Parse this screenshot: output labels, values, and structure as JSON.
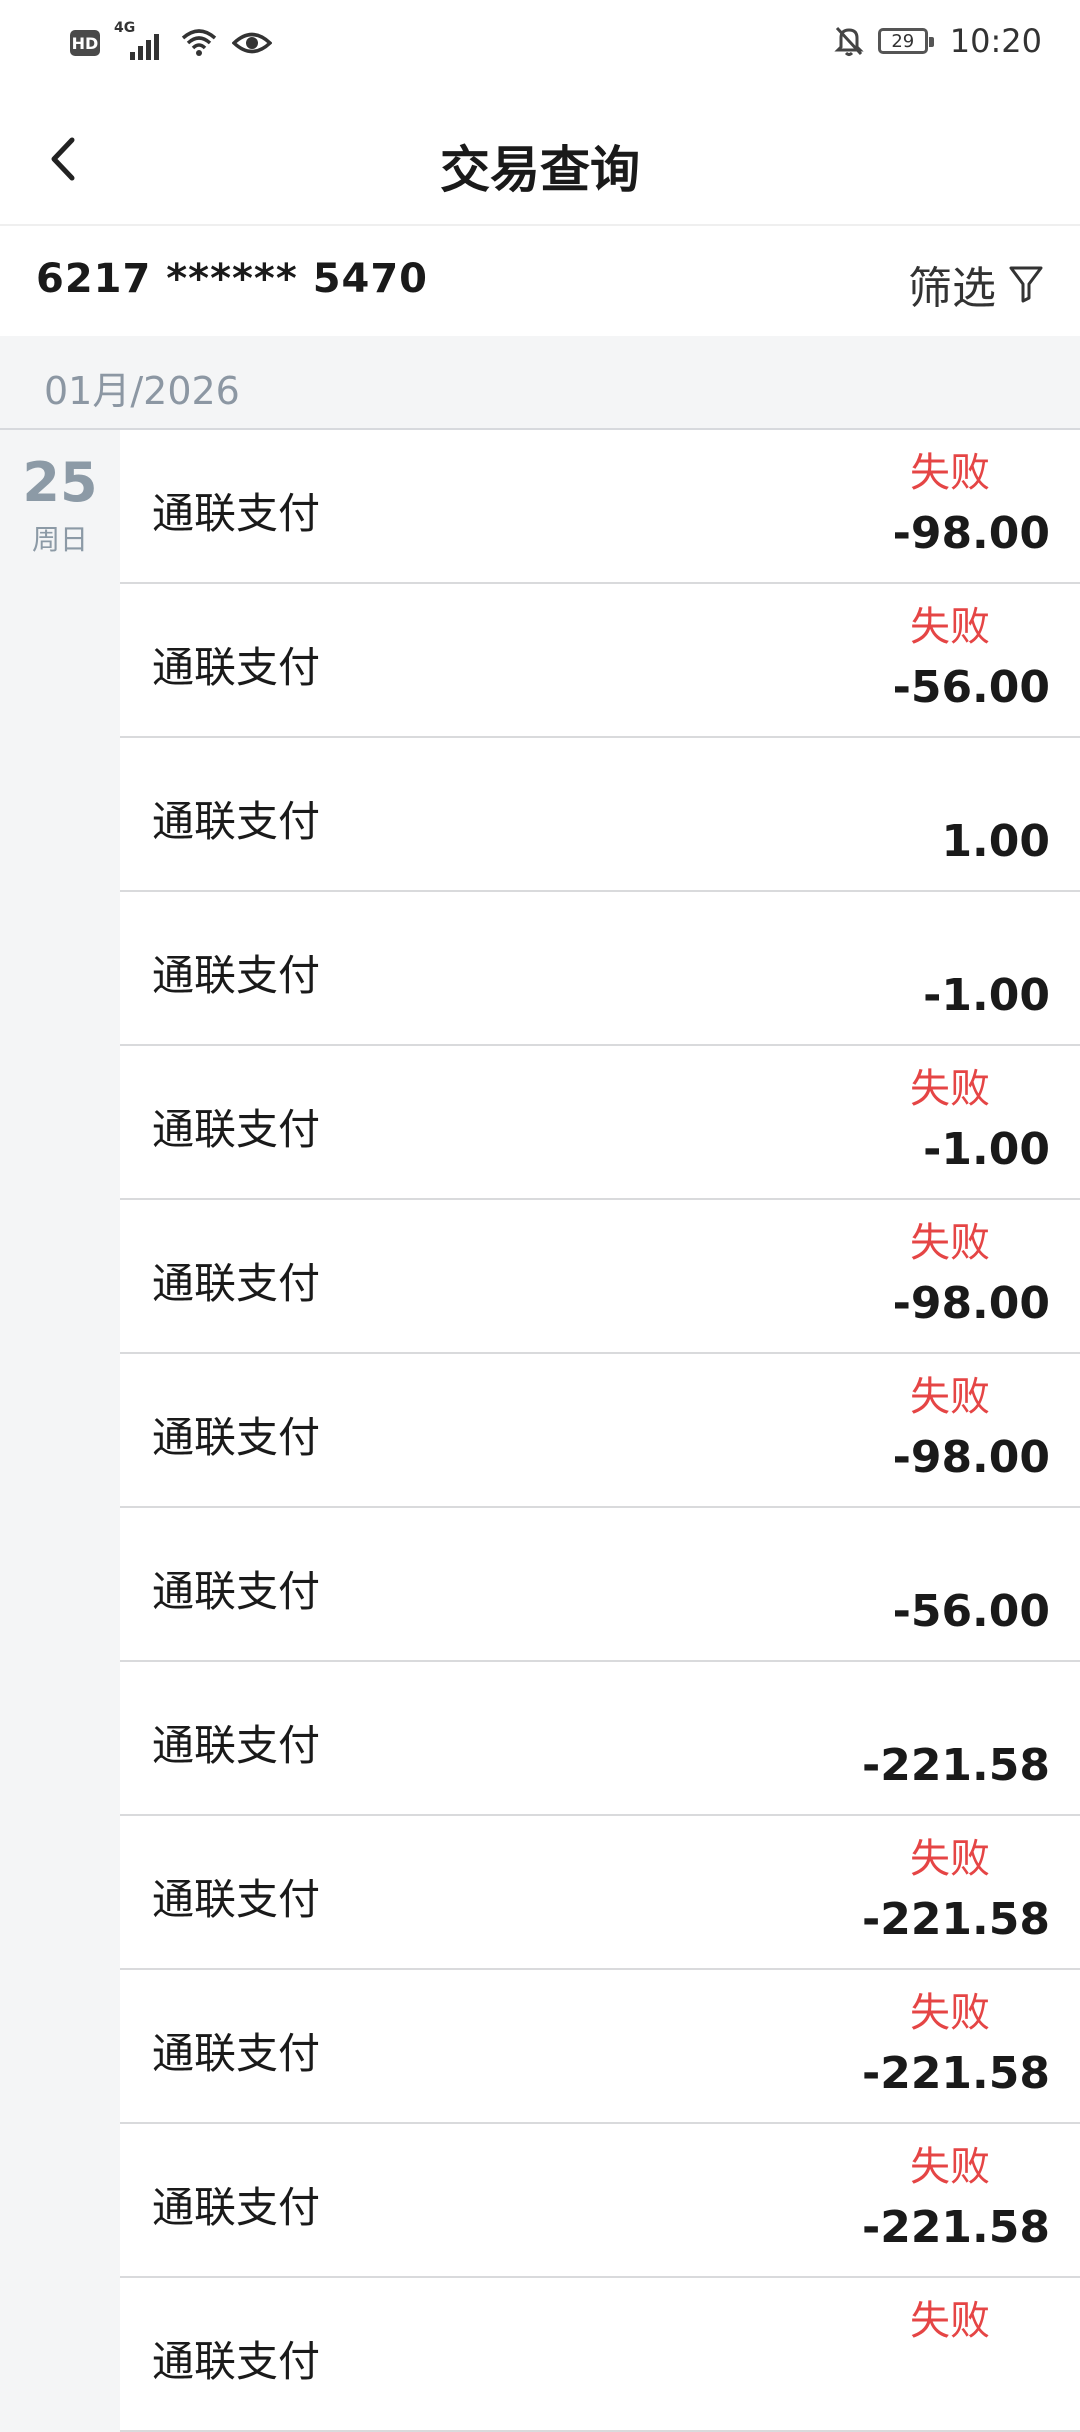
{
  "status_bar": {
    "hd": "HD",
    "network": "4G",
    "battery": "29",
    "time": "10:20"
  },
  "header": {
    "title": "交易查询"
  },
  "account": {
    "number": "6217 ****** 5470",
    "filter_label": "筛选"
  },
  "month": "01月/2026",
  "day": {
    "date": "25",
    "weekday": "周日"
  },
  "transactions": [
    {
      "name": "通联支付",
      "status": "失败",
      "amount": "-98.00"
    },
    {
      "name": "通联支付",
      "status": "失败",
      "amount": "-56.00"
    },
    {
      "name": "通联支付",
      "status": "",
      "amount": "1.00"
    },
    {
      "name": "通联支付",
      "status": "",
      "amount": "-1.00"
    },
    {
      "name": "通联支付",
      "status": "失败",
      "amount": "-1.00"
    },
    {
      "name": "通联支付",
      "status": "失败",
      "amount": "-98.00"
    },
    {
      "name": "通联支付",
      "status": "失败",
      "amount": "-98.00"
    },
    {
      "name": "通联支付",
      "status": "",
      "amount": "-56.00"
    },
    {
      "name": "通联支付",
      "status": "",
      "amount": "-221.58"
    },
    {
      "name": "通联支付",
      "status": "失败",
      "amount": "-221.58"
    },
    {
      "name": "通联支付",
      "status": "失败",
      "amount": "-221.58"
    },
    {
      "name": "通联支付",
      "status": "失败",
      "amount": "-221.58"
    },
    {
      "name": "通联支付",
      "status": "失败",
      "amount": ""
    }
  ]
}
